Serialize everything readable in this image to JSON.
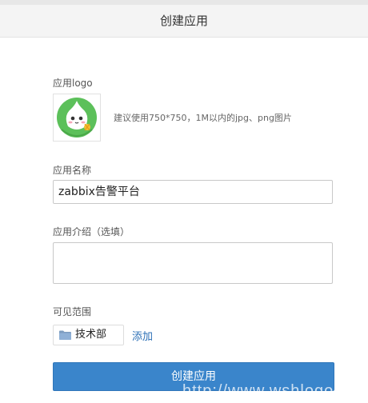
{
  "header": {
    "title": "创建应用"
  },
  "logo_section": {
    "label": "应用logo",
    "hint": "建议使用750*750，1M以内的jpg、png图片",
    "icon": "app-logo-mascot-icon"
  },
  "name_section": {
    "label": "应用名称",
    "value": "zabbix告警平台"
  },
  "intro_section": {
    "label": "应用介绍（选填）",
    "value": ""
  },
  "visibility_section": {
    "label": "可见范围",
    "department": "技术部",
    "add_label": "添加"
  },
  "actions": {
    "create_label": "创建应用"
  },
  "watermark": "http://www.wshlogo",
  "colors": {
    "primary": "#3a85cb",
    "link": "#2b6fb6",
    "header_bg": "#f4f4f4",
    "logo_green": "#5cc05a"
  }
}
